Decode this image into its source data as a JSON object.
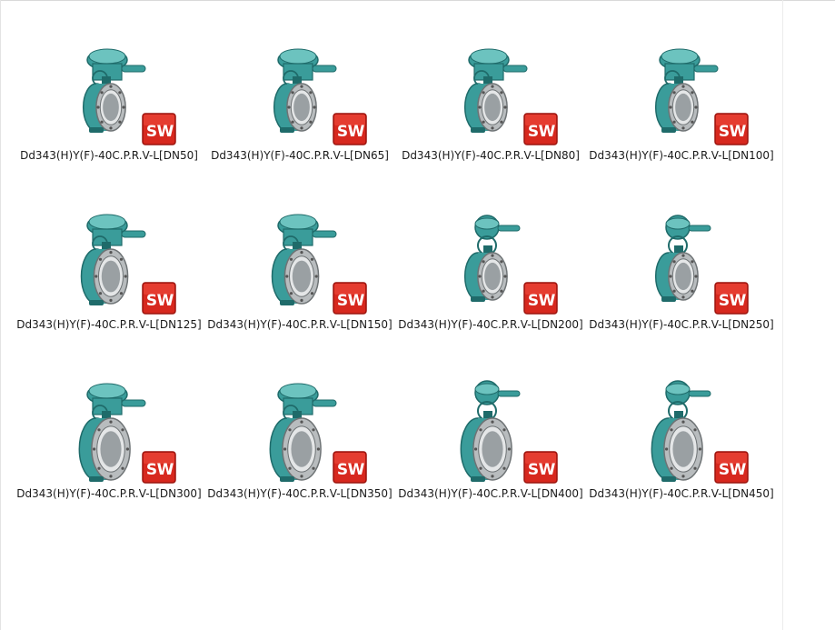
{
  "files": [
    {
      "name": "Dd343(H)Y(F)-40C.P.R.V-L[DN50]",
      "icon": "valve-model-thumbnail",
      "badge": "solidworks-file-icon",
      "model": "small"
    },
    {
      "name": "Dd343(H)Y(F)-40C.P.R.V-L[DN65]",
      "icon": "valve-model-thumbnail",
      "badge": "solidworks-file-icon",
      "model": "small"
    },
    {
      "name": "Dd343(H)Y(F)-40C.P.R.V-L[DN80]",
      "icon": "valve-model-thumbnail",
      "badge": "solidworks-file-icon",
      "model": "small"
    },
    {
      "name": "Dd343(H)Y(F)-40C.P.R.V-L[DN100]",
      "icon": "valve-model-thumbnail",
      "badge": "solidworks-file-icon",
      "model": "small"
    },
    {
      "name": "Dd343(H)Y(F)-40C.P.R.V-L[DN125]",
      "icon": "valve-model-thumbnail",
      "badge": "solidworks-file-icon",
      "model": "medium"
    },
    {
      "name": "Dd343(H)Y(F)-40C.P.R.V-L[DN150]",
      "icon": "valve-model-thumbnail",
      "badge": "solidworks-file-icon",
      "model": "medium"
    },
    {
      "name": "Dd343(H)Y(F)-40C.P.R.V-L[DN200]",
      "icon": "valve-model-thumbnail",
      "badge": "solidworks-file-icon",
      "model": "wheel"
    },
    {
      "name": "Dd343(H)Y(F)-40C.P.R.V-L[DN250]",
      "icon": "valve-model-thumbnail",
      "badge": "solidworks-file-icon",
      "model": "wheel"
    },
    {
      "name": "Dd343(H)Y(F)-40C.P.R.V-L[DN300]",
      "icon": "valve-model-thumbnail",
      "badge": "solidworks-file-icon",
      "model": "large"
    },
    {
      "name": "Dd343(H)Y(F)-40C.P.R.V-L[DN350]",
      "icon": "valve-model-thumbnail",
      "badge": "solidworks-file-icon",
      "model": "large"
    },
    {
      "name": "Dd343(H)Y(F)-40C.P.R.V-L[DN400]",
      "icon": "valve-model-thumbnail",
      "badge": "solidworks-file-icon",
      "model": "wheel-large"
    },
    {
      "name": "Dd343(H)Y(F)-40C.P.R.V-L[DN450]",
      "icon": "valve-model-thumbnail",
      "badge": "solidworks-file-icon",
      "model": "wheel-large"
    }
  ],
  "colors": {
    "valve_teal": "#3a9c9a",
    "valve_teal_dark": "#1f6b6a",
    "valve_teal_light": "#6cc3bf",
    "flange_gray": "#b8bcbe",
    "sw_red": "#d7281e",
    "sw_red_dark": "#9c140e",
    "label_text": "#1a1a1a"
  }
}
